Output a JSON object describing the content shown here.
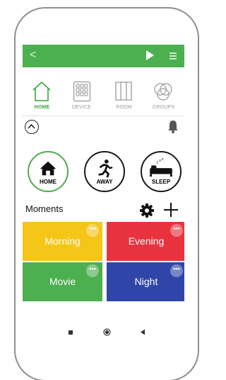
{
  "colors": {
    "topbar": "#4caf50",
    "accent": "#3aa53a",
    "morning": "#f5c518",
    "evening": "#e8323e",
    "movie": "#4caf50",
    "night": "#2f45a8"
  },
  "topbar": {
    "back_icon": "chevron-left-icon",
    "back_glyph": "<",
    "play_icon": "play-icon",
    "menu_icon": "menu-icon"
  },
  "nav": {
    "items": [
      {
        "label": "HOME",
        "icon": "home-outline-icon",
        "active": true
      },
      {
        "label": "DEVICE",
        "icon": "device-grid-icon",
        "active": false
      },
      {
        "label": "ROOM",
        "icon": "room-icon",
        "active": false
      },
      {
        "label": "GROUPS",
        "icon": "groups-icon",
        "active": false
      }
    ]
  },
  "modes": [
    {
      "label": "HOME",
      "icon": "house-icon",
      "active": true
    },
    {
      "label": "AWAY",
      "icon": "running-person-icon",
      "active": false
    },
    {
      "label": "SLEEP",
      "icon": "bed-icon",
      "active": false
    }
  ],
  "moments": {
    "title": "Moments",
    "tiles": [
      {
        "label": "Morning",
        "color": "#f5c518"
      },
      {
        "label": "Evening",
        "color": "#e8323e"
      },
      {
        "label": "Movie",
        "color": "#4caf50"
      },
      {
        "label": "Night",
        "color": "#2f45a8"
      }
    ],
    "more_glyph": "•••"
  },
  "system_nav": [
    "square-icon",
    "circle-icon",
    "triangle-back-icon"
  ]
}
